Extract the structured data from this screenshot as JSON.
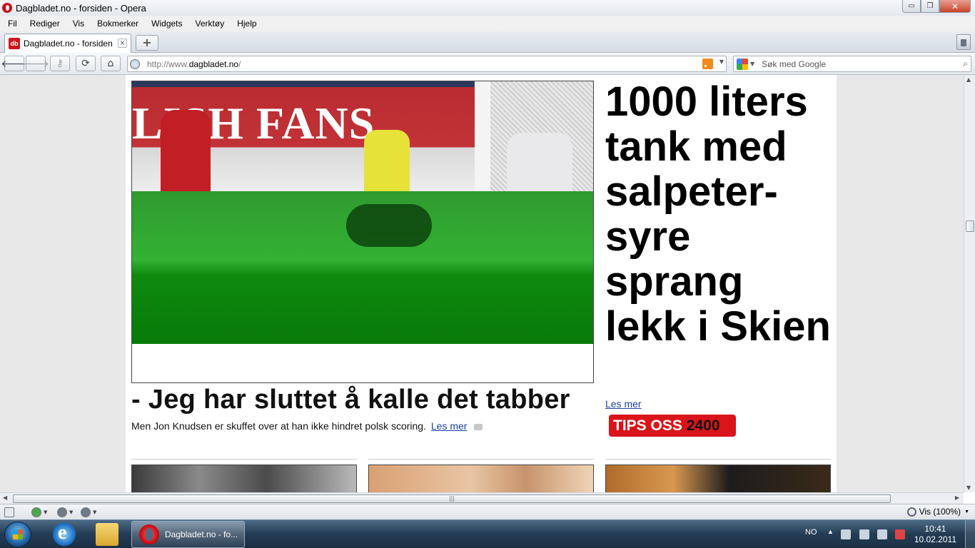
{
  "window": {
    "title": "Dagbladet.no - forsiden - Opera",
    "controls": {
      "minimize": "▭",
      "maximize": "❐",
      "close": "✕"
    }
  },
  "menu": [
    "Fil",
    "Rediger",
    "Vis",
    "Bokmerker",
    "Widgets",
    "Verktøy",
    "Hjelp"
  ],
  "tabs": [
    {
      "label": "Dagbladet.no - forsiden",
      "favicon": "db",
      "close": "×"
    }
  ],
  "new_tab": "+",
  "nav": {
    "back": "🡐",
    "forward": "🡒",
    "wand": "⚷",
    "reload": "⟳",
    "home": "⌂",
    "url_prefix": "http://www.",
    "url_domain": "dagbladet.no",
    "url_suffix": "/",
    "dropdown": "▼",
    "search_placeholder": "Søk med Google",
    "search_icon": "⌕"
  },
  "page": {
    "hero_banner_text": "LISH FANS",
    "headline": "- Jeg har sluttet å kalle det tabber",
    "lede": "Men Jon Knudsen er skuffet over at han ikke hindret polsk scoring.",
    "lede_link": "Les mer",
    "side_headline": "1000 liters tank med salpeter-syre sprang lekk i Skien",
    "side_link": "Les mer",
    "tips_label": "TIPS OSS",
    "tips_number": "2400"
  },
  "scroll": {
    "up": "▲",
    "down": "▼",
    "left": "◀",
    "right": "▶",
    "grip": "|||"
  },
  "status": {
    "zoom_label": "Vis (100%)",
    "dropdown": "▼"
  },
  "taskbar": {
    "task_label": "Dagbladet.no - fo...",
    "lang": "NO",
    "tray_chevron": "▲",
    "time": "10:41",
    "date": "10.02.2011"
  },
  "colors": {
    "opera_red": "#cc0f16",
    "link_blue": "#1a3fa8",
    "tips_red": "#d9141a"
  }
}
